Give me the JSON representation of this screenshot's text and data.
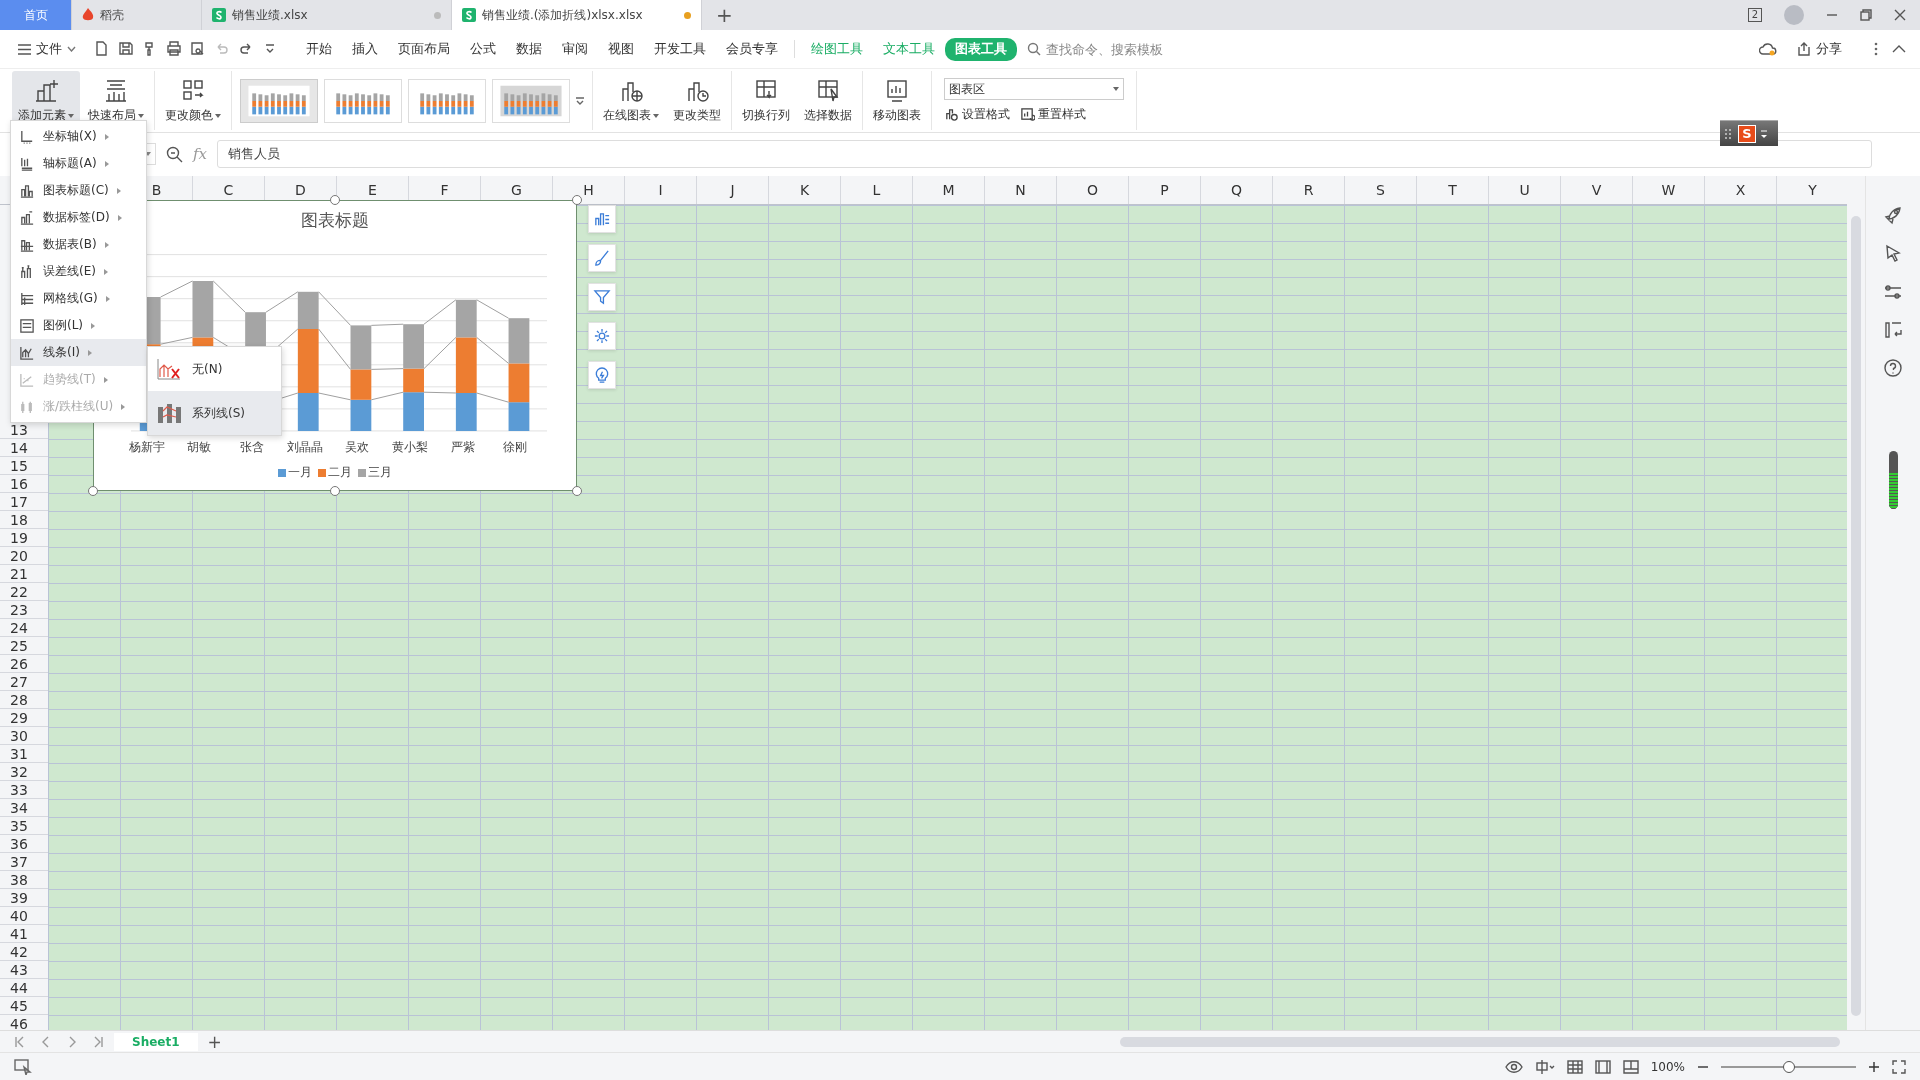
{
  "tabs": [
    {
      "label": "首页",
      "kind": "home",
      "selected": false
    },
    {
      "label": "稻壳",
      "kind": "docer",
      "selected": false
    },
    {
      "label": "销售业绩.xlsx",
      "kind": "sheet",
      "selected": false,
      "modified": false
    },
    {
      "label": "销售业绩.(添加折线)xlsx.xlsx",
      "kind": "sheet",
      "selected": true,
      "modified": true
    }
  ],
  "new_tab_label": "+",
  "window_badge": "2",
  "menu_bar": {
    "file_label": "文件",
    "tabs": [
      {
        "label": "开始",
        "kind": "main",
        "selected": false
      },
      {
        "label": "插入",
        "kind": "main",
        "selected": false
      },
      {
        "label": "页面布局",
        "kind": "main",
        "selected": false
      },
      {
        "label": "公式",
        "kind": "main",
        "selected": false
      },
      {
        "label": "数据",
        "kind": "main",
        "selected": false
      },
      {
        "label": "审阅",
        "kind": "main",
        "selected": false
      },
      {
        "label": "视图",
        "kind": "main",
        "selected": false
      },
      {
        "label": "开发工具",
        "kind": "main",
        "selected": false
      },
      {
        "label": "会员专享",
        "kind": "main",
        "selected": false
      },
      {
        "label": "绘图工具",
        "kind": "context",
        "selected": false
      },
      {
        "label": "文本工具",
        "kind": "context",
        "selected": false
      },
      {
        "label": "图表工具",
        "kind": "context",
        "selected": true
      }
    ],
    "search": {
      "placeholder": "查找命令、搜索模板"
    },
    "share_label": "分享"
  },
  "ribbon": [
    {
      "kind": "buttons",
      "buttons": [
        {
          "label": "添加元素",
          "dropdown": true,
          "selected": true
        },
        {
          "label": "快速布局",
          "dropdown": true,
          "selected": false
        }
      ]
    },
    {
      "kind": "buttons",
      "buttons": [
        {
          "label": "更改颜色",
          "dropdown": true,
          "selected": false
        }
      ]
    },
    {
      "kind": "styles",
      "styles": [
        {
          "selected": true
        },
        {
          "selected": false
        },
        {
          "selected": false
        },
        {
          "selected": false
        }
      ]
    },
    {
      "kind": "buttons",
      "buttons": [
        {
          "label": "在线图表",
          "dropdown": true,
          "selected": false
        },
        {
          "label": "更改类型",
          "dropdown": false,
          "selected": false
        }
      ]
    },
    {
      "kind": "buttons",
      "buttons": [
        {
          "label": "切换行列",
          "dropdown": false,
          "selected": false
        },
        {
          "label": "选择数据",
          "dropdown": false,
          "selected": false
        }
      ]
    },
    {
      "kind": "buttons",
      "buttons": [
        {
          "label": "移动图表",
          "dropdown": false,
          "selected": false
        }
      ]
    },
    {
      "kind": "format",
      "element_select": {
        "value": "图表区"
      },
      "buttons": [
        "设置格式",
        "重置样式"
      ]
    }
  ],
  "formula_bar": {
    "fx_label": "fx",
    "value": "销售人员"
  },
  "columns": [
    "B",
    "C",
    "D",
    "E",
    "F",
    "G",
    "H",
    "I",
    "J",
    "K",
    "L",
    "M",
    "N",
    "O",
    "P",
    "Q",
    "R",
    "S",
    "T",
    "U",
    "V",
    "W",
    "X",
    "Y"
  ],
  "rows": [
    "13",
    "14",
    "15",
    "16",
    "17",
    "18",
    "19",
    "20",
    "21",
    "22",
    "23",
    "24",
    "25",
    "26",
    "27",
    "28",
    "29",
    "30",
    "31",
    "32",
    "33",
    "34",
    "35",
    "36",
    "37",
    "38",
    "39",
    "40",
    "41",
    "42",
    "43",
    "44",
    "45",
    "46"
  ],
  "chart": {
    "title": "图表标题",
    "categories": [
      "杨新宇",
      "胡敏",
      "张含",
      "刘晶晶",
      "吴欢",
      "黄小梨",
      "严紫",
      "徐刚"
    ],
    "legend": [
      {
        "label": "一月",
        "color": "#5b9bd5"
      },
      {
        "label": "二月",
        "color": "#ed7d31"
      },
      {
        "label": "三月",
        "color": "#a5a5a5"
      }
    ]
  },
  "add_element_menu": {
    "items": [
      {
        "label": "坐标轴(X)",
        "disabled": false,
        "selected": false
      },
      {
        "label": "轴标题(A)",
        "disabled": false,
        "selected": false
      },
      {
        "label": "图表标题(C)",
        "disabled": false,
        "selected": false
      },
      {
        "label": "数据标签(D)",
        "disabled": false,
        "selected": false
      },
      {
        "label": "数据表(B)",
        "disabled": false,
        "selected": false
      },
      {
        "label": "误差线(E)",
        "disabled": false,
        "selected": false
      },
      {
        "label": "网格线(G)",
        "disabled": false,
        "selected": false
      },
      {
        "label": "图例(L)",
        "disabled": false,
        "selected": false
      },
      {
        "label": "线条(I)",
        "disabled": false,
        "selected": true
      },
      {
        "label": "趋势线(T)",
        "disabled": true,
        "selected": false
      },
      {
        "label": "涨/跌柱线(U)",
        "disabled": true,
        "selected": false
      }
    ]
  },
  "lines_submenu": {
    "items": [
      {
        "label": "无(N)",
        "selected": false
      },
      {
        "label": "系列线(S)",
        "selected": true
      }
    ]
  },
  "sheet_tabs": [
    {
      "label": "Sheet1",
      "selected": true
    }
  ],
  "add_sheet_label": "+",
  "status_bar": {
    "zoom_label": "100%",
    "zoom_slider": {
      "level": 0.5
    }
  },
  "ime_toolbar": {
    "logo": "S"
  }
}
